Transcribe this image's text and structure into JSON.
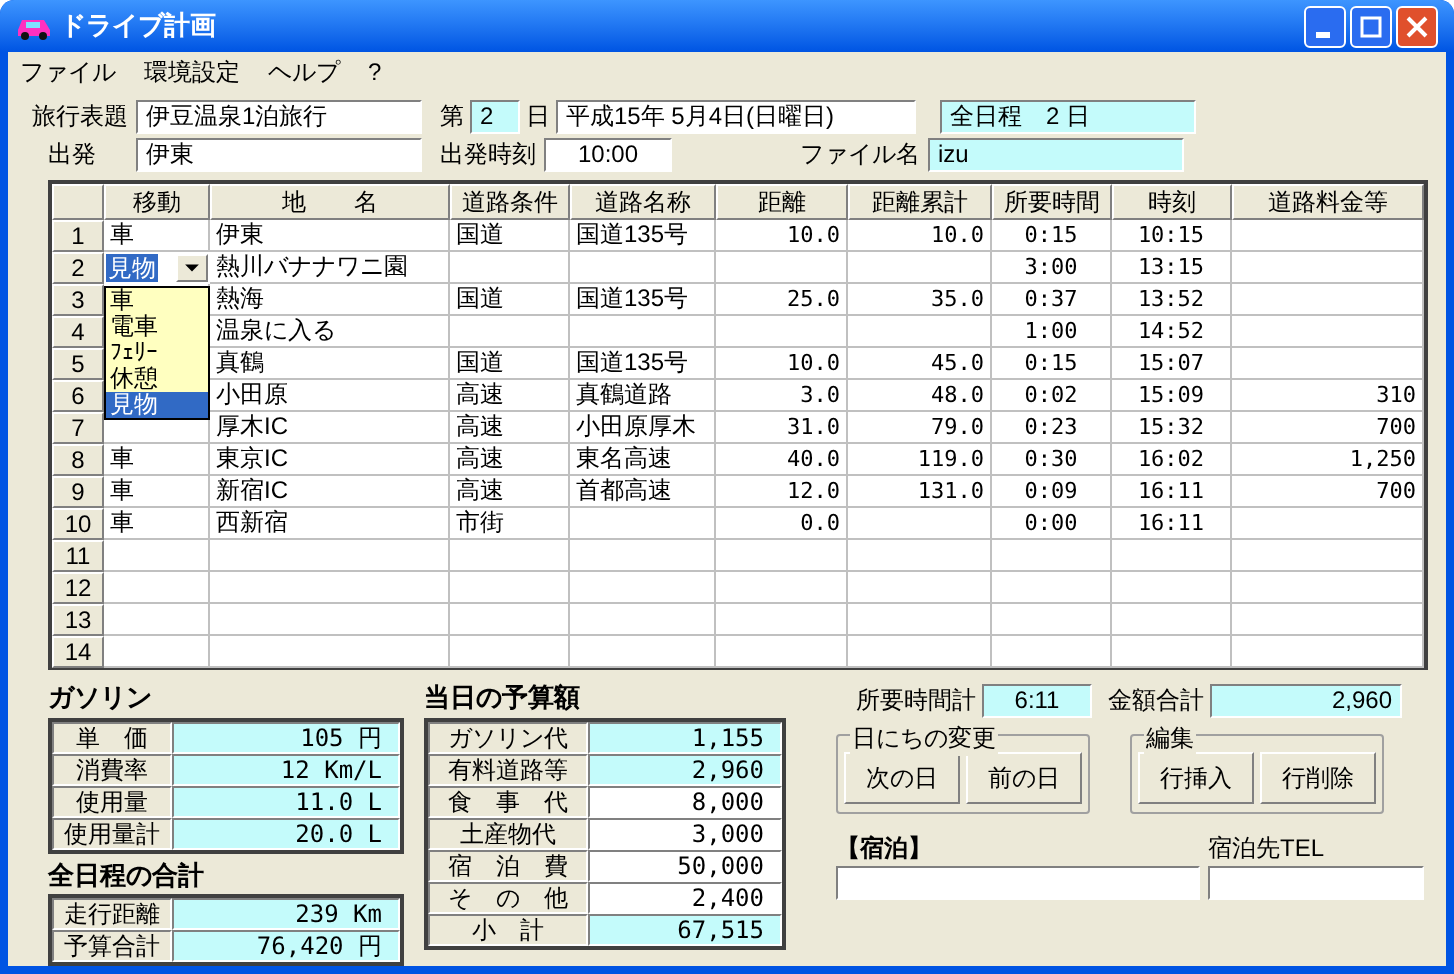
{
  "window": {
    "title": "ドライブ計画"
  },
  "menu": [
    "ファイル",
    "環境設定",
    "ヘルプ",
    "?"
  ],
  "header": {
    "trip_title": {
      "label": "旅行表題",
      "value": "伊豆温泉1泊旅行"
    },
    "day": {
      "prefix": "第",
      "value": "2",
      "suffix": "日"
    },
    "date": "平成15年 5月4日(日曜日)",
    "total_days": "全日程　2 日",
    "departure": {
      "label": "出発",
      "value": "伊東"
    },
    "departure_time": {
      "label": "出発時刻",
      "value": "10:00"
    },
    "file_name": {
      "label": "ファイル名",
      "value": "izu"
    }
  },
  "table": {
    "columns": [
      "移動",
      "地　　名",
      "道路条件",
      "道路名称",
      "距離",
      "距離累計",
      "所要時間",
      "時刻",
      "道路料金等"
    ],
    "rows": [
      {
        "number": "1",
        "move": "車",
        "place": "伊東",
        "road_type": "国道",
        "road_name": "国道135号",
        "distance": "10.0",
        "cumulative": "10.0",
        "duration": "0:15",
        "time": "10:15",
        "toll": ""
      },
      {
        "number": "2",
        "move": "",
        "move_editor": {
          "value": "見物",
          "options": [
            {
              "label": "車",
              "selected": false
            },
            {
              "label": "電車",
              "selected": false
            },
            {
              "label": "ﾌｪﾘｰ",
              "selected": false
            },
            {
              "label": "休憩",
              "selected": false
            },
            {
              "label": "見物",
              "selected": true
            }
          ]
        },
        "place": "熱川バナナワニ園",
        "road_type": "",
        "road_name": "",
        "distance": "",
        "cumulative": "",
        "duration": "3:00",
        "time": "13:15",
        "toll": ""
      },
      {
        "number": "3",
        "move": "",
        "place": "熱海",
        "road_type": "国道",
        "road_name": "国道135号",
        "distance": "25.0",
        "cumulative": "35.0",
        "duration": "0:37",
        "time": "13:52",
        "toll": ""
      },
      {
        "number": "4",
        "move": "",
        "place": "温泉に入る",
        "road_type": "",
        "road_name": "",
        "distance": "",
        "cumulative": "",
        "duration": "1:00",
        "time": "14:52",
        "toll": ""
      },
      {
        "number": "5",
        "move": "",
        "place": "真鶴",
        "road_type": "国道",
        "road_name": "国道135号",
        "distance": "10.0",
        "cumulative": "45.0",
        "duration": "0:15",
        "time": "15:07",
        "toll": ""
      },
      {
        "number": "6",
        "move": "",
        "place": "小田原",
        "road_type": "高速",
        "road_name": "真鶴道路",
        "distance": "3.0",
        "cumulative": "48.0",
        "duration": "0:02",
        "time": "15:09",
        "toll": "310"
      },
      {
        "number": "7",
        "move": "",
        "place": "厚木IC",
        "road_type": "高速",
        "road_name": "小田原厚木",
        "distance": "31.0",
        "cumulative": "79.0",
        "duration": "0:23",
        "time": "15:32",
        "toll": "700"
      },
      {
        "number": "8",
        "move": "車",
        "place": "東京IC",
        "road_type": "高速",
        "road_name": "東名高速",
        "distance": "40.0",
        "cumulative": "119.0",
        "duration": "0:30",
        "time": "16:02",
        "toll": "1,250"
      },
      {
        "number": "9",
        "move": "車",
        "place": "新宿IC",
        "road_type": "高速",
        "road_name": "首都高速",
        "distance": "12.0",
        "cumulative": "131.0",
        "duration": "0:09",
        "time": "16:11",
        "toll": "700"
      },
      {
        "number": "10",
        "move": "車",
        "place": "西新宿",
        "road_type": "市街",
        "road_name": "",
        "distance": "0.0",
        "cumulative": "",
        "duration": "0:00",
        "time": "16:11",
        "toll": ""
      },
      {
        "number": "11",
        "move": "",
        "place": "",
        "road_type": "",
        "road_name": "",
        "distance": "",
        "cumulative": "",
        "duration": "",
        "time": "",
        "toll": ""
      },
      {
        "number": "12",
        "move": "",
        "place": "",
        "road_type": "",
        "road_name": "",
        "distance": "",
        "cumulative": "",
        "duration": "",
        "time": "",
        "toll": ""
      },
      {
        "number": "13",
        "move": "",
        "place": "",
        "road_type": "",
        "road_name": "",
        "distance": "",
        "cumulative": "",
        "duration": "",
        "time": "",
        "toll": ""
      },
      {
        "number": "14",
        "move": "",
        "place": "",
        "road_type": "",
        "road_name": "",
        "distance": "",
        "cumulative": "",
        "duration": "",
        "time": "",
        "toll": ""
      }
    ]
  },
  "gasoline": {
    "title": "ガソリン",
    "rows": [
      {
        "label": "単　価",
        "value": "105 円"
      },
      {
        "label": "消費率",
        "value": "12 Km/L"
      },
      {
        "label": "使用量",
        "value": "11.0 L"
      },
      {
        "label": "使用量計",
        "value": "20.0 L"
      }
    ]
  },
  "trip_totals": {
    "title": "全日程の合計",
    "rows": [
      {
        "label": "走行距離",
        "value": "239 Km"
      },
      {
        "label": "予算合計",
        "value": "76,420 円"
      }
    ]
  },
  "budget": {
    "title": "当日の予算額",
    "rows": [
      {
        "label": "ガソリン代",
        "value": "1,155",
        "editable": false
      },
      {
        "label": "有料道路等",
        "value": "2,960",
        "editable": false
      },
      {
        "label": "食　事　代",
        "value": "8,000",
        "editable": true
      },
      {
        "label": "土産物代",
        "value": "3,000",
        "editable": true
      },
      {
        "label": "宿　泊　費",
        "value": "50,000",
        "editable": true
      },
      {
        "label": "そ　の　他",
        "value": "2,400",
        "editable": true
      },
      {
        "label": "小　計",
        "value": "67,515",
        "editable": false
      }
    ]
  },
  "summary": {
    "duration_total": {
      "label": "所要時間計",
      "value": "6:11"
    },
    "amount_total": {
      "label": "金額合計",
      "value": "2,960"
    }
  },
  "groups": [
    {
      "title": "日にちの変更",
      "buttons": [
        "次の日",
        "前の日"
      ]
    },
    {
      "title": "編集",
      "buttons": [
        "行挿入",
        "行削除"
      ]
    }
  ],
  "lodging": {
    "label": "【宿泊】",
    "tel_label": "宿泊先TEL"
  }
}
